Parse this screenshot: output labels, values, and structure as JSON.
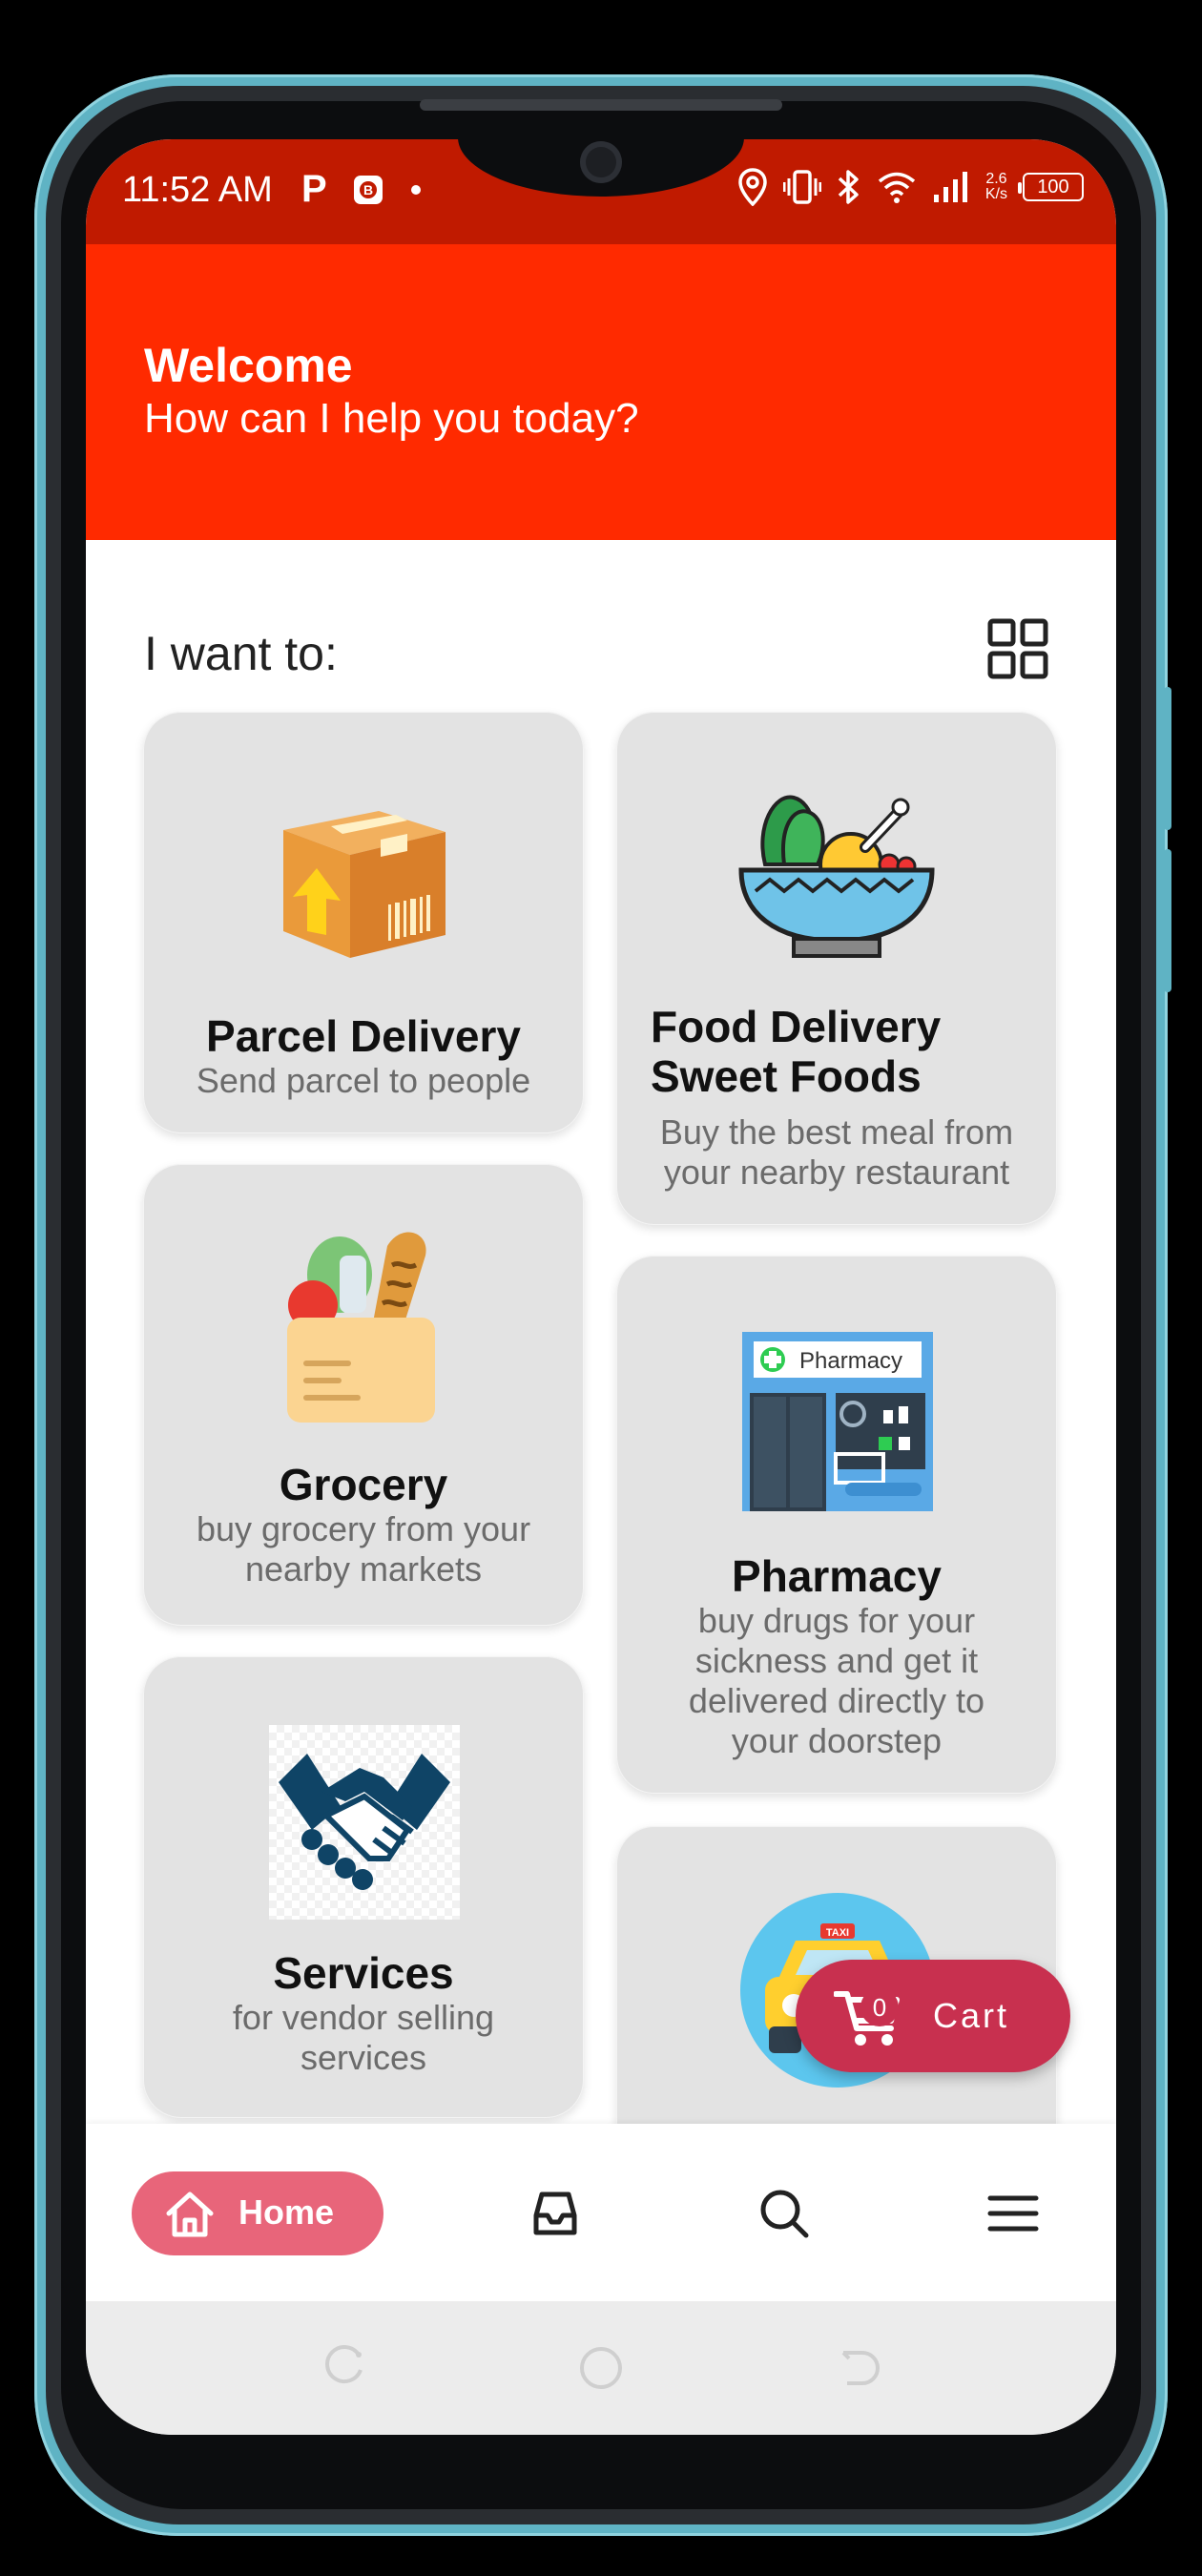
{
  "status_bar": {
    "time": "11:52 AM",
    "p_icon_text": "P",
    "speed_value": "2.6",
    "speed_unit": "K/s",
    "battery": "100",
    "icons": [
      "parking-icon",
      "app-notification-icon",
      "dot-icon",
      "location-icon",
      "vibrate-icon",
      "bluetooth-icon",
      "wifi-icon",
      "signal-icon",
      "battery-icon"
    ]
  },
  "header": {
    "title": "Welcome",
    "subtitle": "How can I help you today?",
    "background": "#ff2a00"
  },
  "main": {
    "section_label": "I want to:",
    "view_toggle_icon": "grid-view-icon",
    "cards": [
      {
        "title": "Parcel Delivery",
        "description": "Send parcel to people",
        "icon": "parcel-box-icon"
      },
      {
        "title": "Food Delivery Sweet Foods",
        "title_line1": "Food Delivery",
        "title_line2": "Sweet Foods",
        "description": "Buy the best meal from your nearby restaurant",
        "desc_line1": "Buy the best meal from",
        "desc_line2": "your nearby restaurant",
        "icon": "food-bowl-icon"
      },
      {
        "title": "Grocery",
        "description": "buy grocery from your nearby markets",
        "desc_line1": "buy grocery from your",
        "desc_line2": "nearby markets",
        "icon": "grocery-bag-icon"
      },
      {
        "title": "Pharmacy",
        "sign_text": "Pharmacy",
        "description": "buy drugs for your sickness and get it delivered directly to your doorstep",
        "desc_line1": "buy drugs for your",
        "desc_line2": "sickness and get it",
        "desc_line3": "delivered directly to",
        "desc_line4": "your doorstep",
        "icon": "pharmacy-store-icon"
      },
      {
        "title": "Services",
        "description": "for vendor selling services",
        "desc_line1": "for vendor selling",
        "desc_line2": "services",
        "icon": "handshake-icon"
      },
      {
        "title": "",
        "sign_text": "TAXI",
        "icon": "taxi-icon"
      }
    ]
  },
  "cart": {
    "count": "0",
    "label": "Cart",
    "color": "#c8304f"
  },
  "bottom_nav": {
    "home_label": "Home",
    "active_color": "#e8657a",
    "items": [
      "home-icon",
      "inbox-icon",
      "search-icon",
      "menu-icon"
    ]
  },
  "system_nav": {
    "items": [
      "recent-apps-icon",
      "home-circle-icon",
      "back-icon"
    ]
  }
}
